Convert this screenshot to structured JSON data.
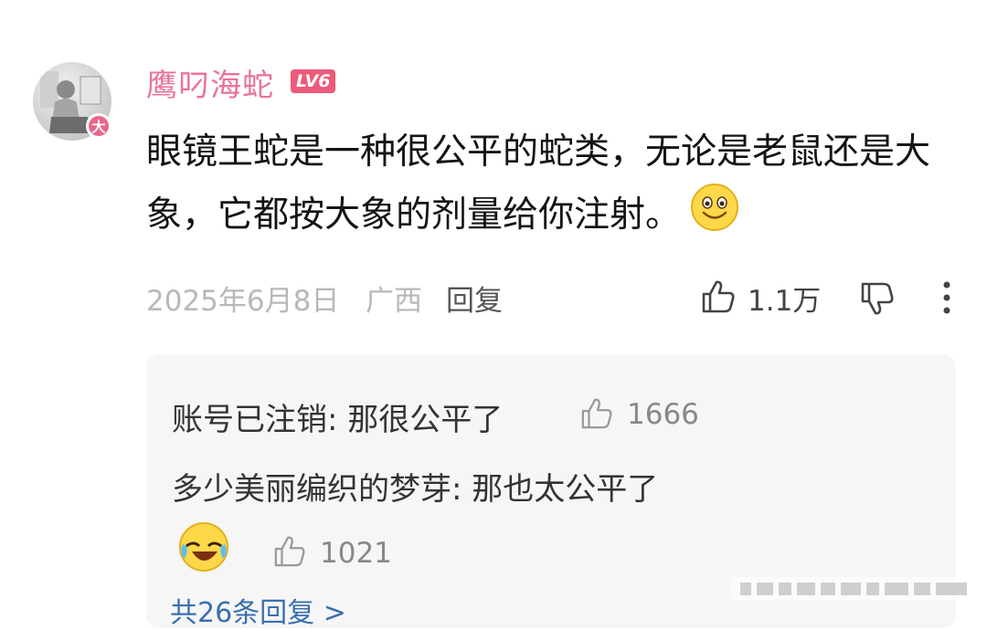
{
  "comment": {
    "username": "鹰叼海蛇",
    "level": "LV6",
    "avatar_badge": "大",
    "text": "眼镜王蛇是一种很公平的蛇类，无论是老鼠还是大象，它都按大象的剂量给你注射。",
    "date": "2025年6月8日",
    "location": "广西",
    "reply_label": "回复",
    "like_count": "1.1万",
    "icons": [
      "thumbs-up-icon",
      "thumbs-down-icon",
      "more-vertical-icon",
      "smile-emoji-icon"
    ]
  },
  "replies": [
    {
      "author": "账号已注销",
      "text": "那很公平了",
      "likes": "1666"
    },
    {
      "author": "多少美丽编织的梦芽",
      "text": "那也太公平了",
      "likes": "1021",
      "emoji": "laugh-cry-emoji-icon"
    }
  ],
  "more_replies": "共26条回复 >",
  "colors": {
    "username": "#e8739a",
    "level_badge": "#ee5a7a",
    "reply_bg": "#f6f6f6"
  }
}
